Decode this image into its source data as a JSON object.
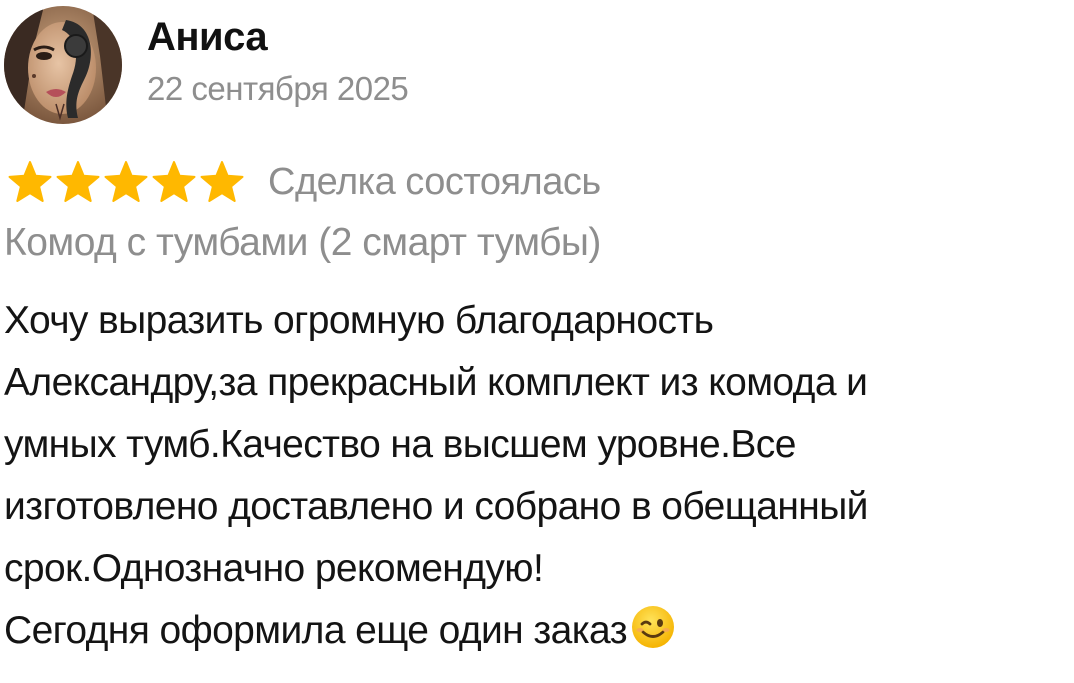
{
  "review": {
    "author": "Аниса",
    "date": "22 сентября 2025",
    "rating": 5,
    "rating_max": 5,
    "star_color": "#ffb800",
    "status": "Сделка состоялась",
    "product": "Комод с тумбами (2 смарт тумбы)",
    "text_lines": [
      "Хочу выразить огромную благодарность",
      "Александру,за прекрасный комплект из комода и",
      "умных тумб.Качество на высшем уровне.Все",
      "изготовлено доставлено и собрано в обещанный",
      "срок.Однозначно рекомендую!",
      "Сегодня оформила еще один заказ"
    ],
    "trailing_emoji": "winking-face-emoji"
  },
  "icons": {
    "avatar": "user-avatar-photo",
    "star": "star-icon"
  }
}
